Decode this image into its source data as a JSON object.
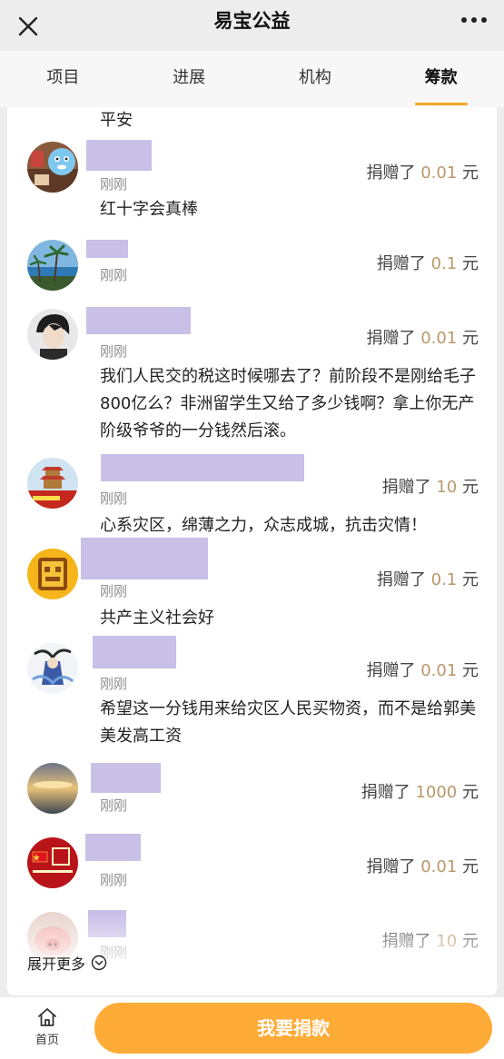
{
  "header": {
    "title": "易宝公益"
  },
  "tabs": [
    {
      "label": "项目"
    },
    {
      "label": "进展"
    },
    {
      "label": "机构"
    },
    {
      "label": "筹款",
      "active": true
    }
  ],
  "list": {
    "top_comment": "平安",
    "donations": [
      {
        "time": "刚刚",
        "amount_prefix": "捐赠了",
        "amount": "0.01",
        "unit": "元",
        "comment": "红十字会真棒"
      },
      {
        "time": "刚刚",
        "amount_prefix": "捐赠了",
        "amount": "0.1",
        "unit": "元",
        "comment": ""
      },
      {
        "time": "刚刚",
        "amount_prefix": "捐赠了",
        "amount": "0.01",
        "unit": "元",
        "comment": "我们人民交的税这时候哪去了？前阶段不是刚给毛子800亿么？非洲留学生又给了多少钱啊？拿上你无产阶级爷爷的一分钱然后滚。"
      },
      {
        "time": "刚刚",
        "amount_prefix": "捐赠了",
        "amount": "10",
        "unit": "元",
        "comment": "心系灾区，绵薄之力，众志成城，抗击灾情！"
      },
      {
        "time": "刚刚",
        "amount_prefix": "捐赠了",
        "amount": "0.1",
        "unit": "元",
        "comment": "共产主义社会好"
      },
      {
        "time": "刚刚",
        "amount_prefix": "捐赠了",
        "amount": "0.01",
        "unit": "元",
        "comment": "希望这一分钱用来给灾区人民买物资，而不是给郭美美发高工资"
      },
      {
        "time": "刚刚",
        "amount_prefix": "捐赠了",
        "amount": "1000",
        "unit": "元",
        "comment": ""
      },
      {
        "time": "刚刚",
        "amount_prefix": "捐赠了",
        "amount": "0.01",
        "unit": "元",
        "comment": ""
      },
      {
        "time": "刚刚",
        "amount_prefix": "捐赠了",
        "amount": "10",
        "unit": "元",
        "comment": ""
      }
    ],
    "expand_label": "展开更多"
  },
  "footer": {
    "home_label": "首页",
    "donate_label": "我要捐款"
  },
  "colors": {
    "accent": "#ffab37",
    "amount": "#b9986a",
    "redacted": "#c9c0e8"
  }
}
